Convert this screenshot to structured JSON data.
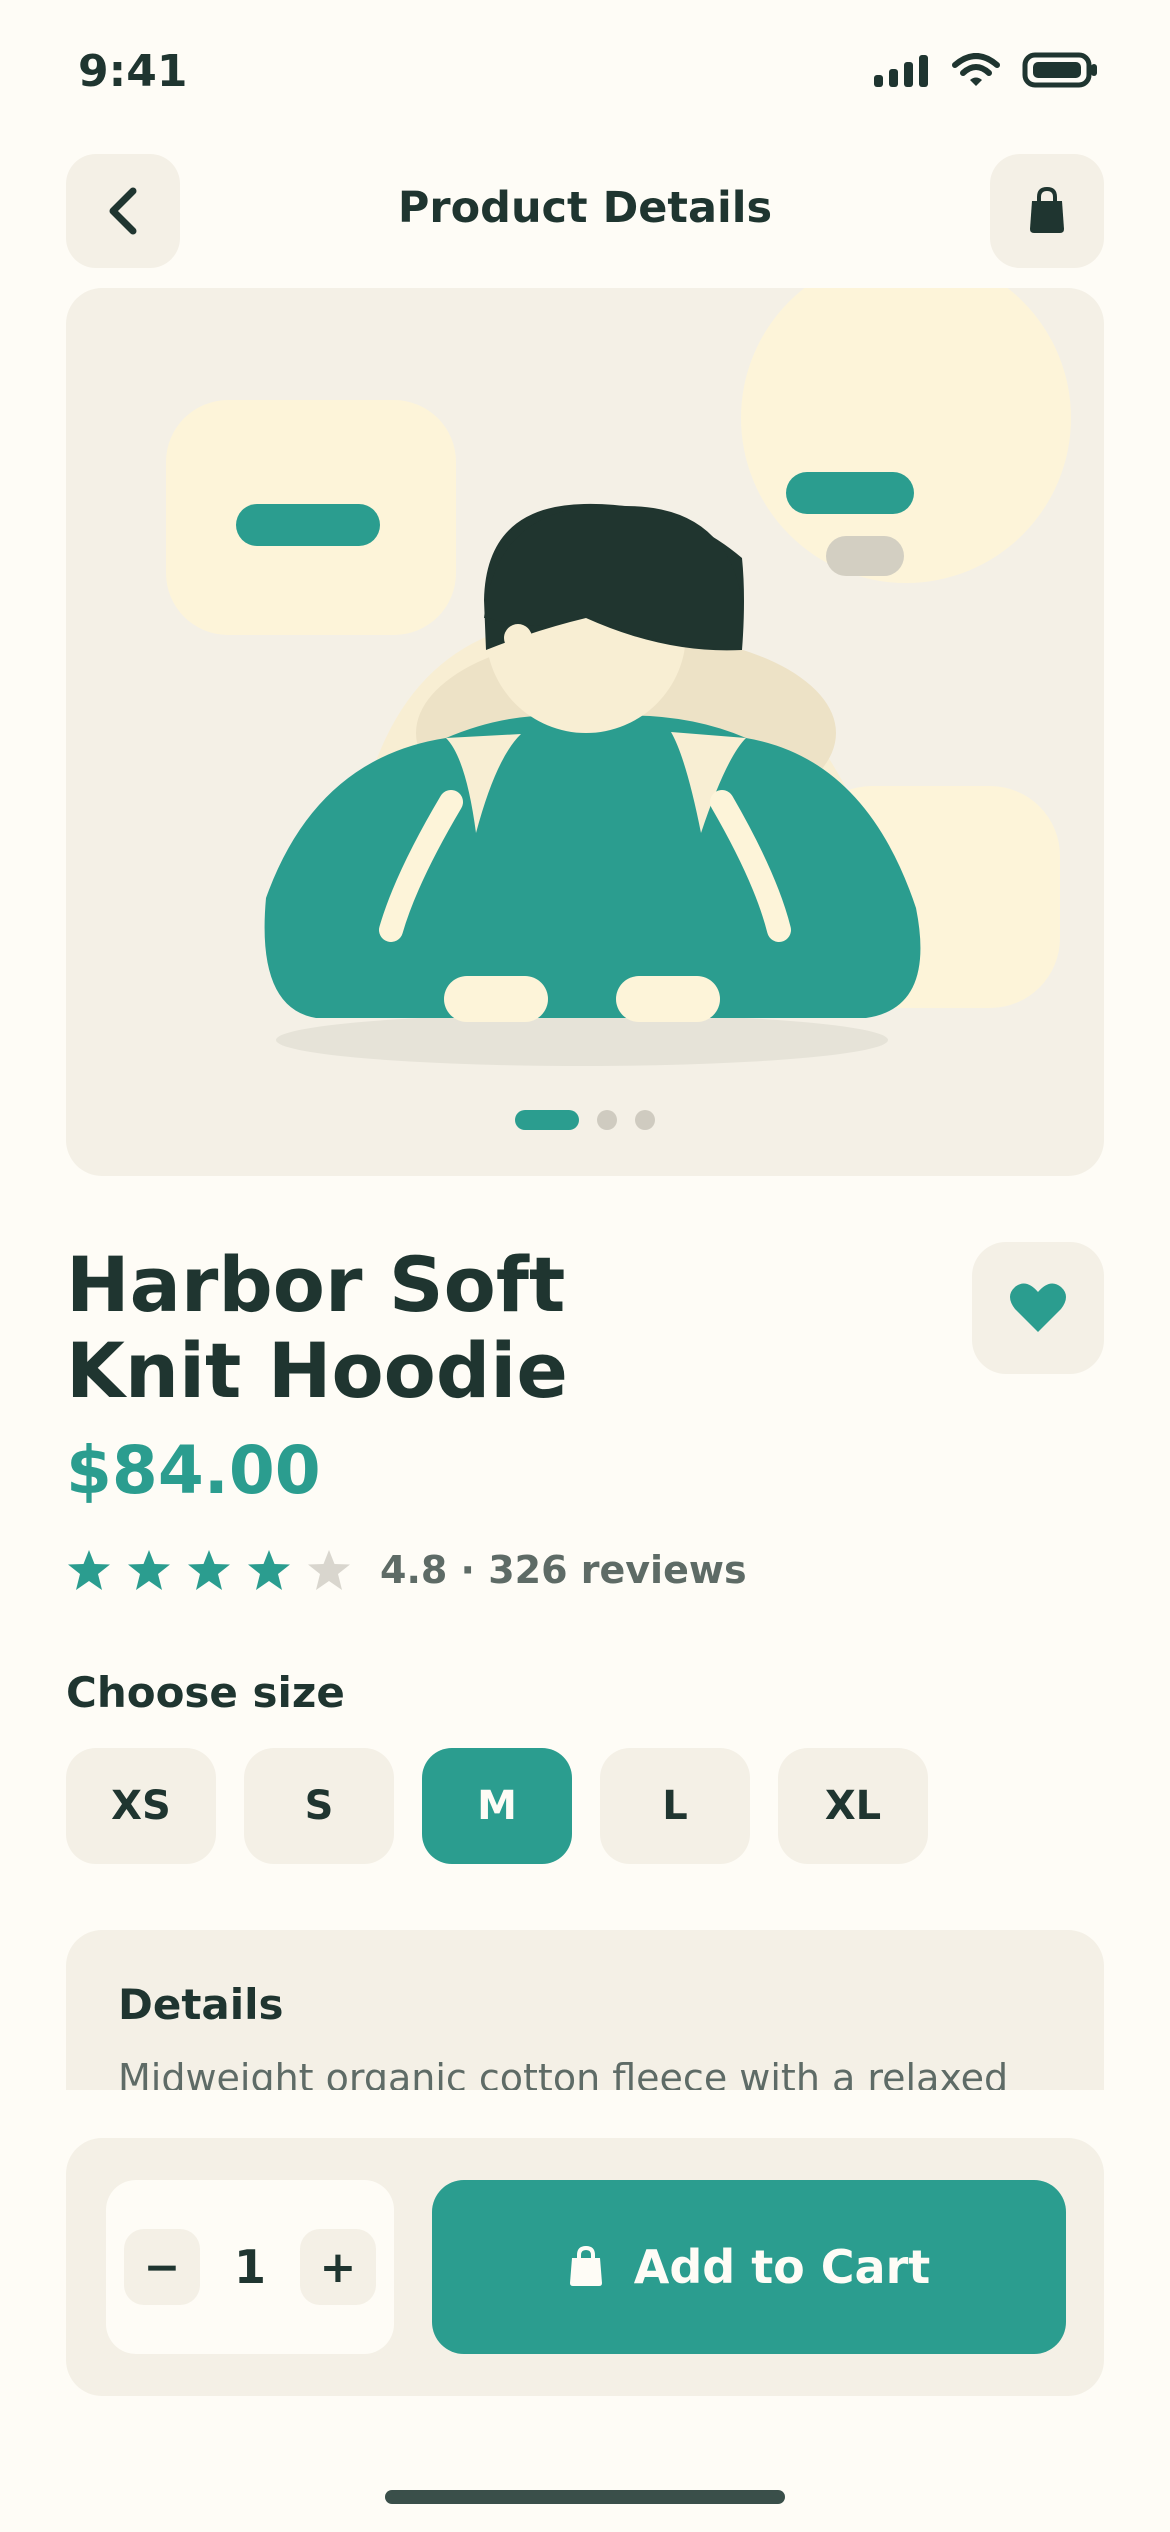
{
  "status_bar": {
    "time": "9:41",
    "icons": [
      "signal-icon",
      "wifi-icon",
      "battery-icon"
    ]
  },
  "header": {
    "title": "Product Details",
    "back_icon": "chevron-left-icon",
    "bag_icon": "shopping-bag-icon"
  },
  "gallery": {
    "image_count": 3,
    "active_index": 0
  },
  "product": {
    "name": "Harbor Soft Knit Hoodie",
    "price": "$84.00",
    "rating": 4.8,
    "rating_text": "4.8 · 326 reviews",
    "stars_filled": 4,
    "stars_total": 5
  },
  "size": {
    "label": "Choose size",
    "options": [
      "XS",
      "S",
      "M",
      "L",
      "XL"
    ],
    "selected": "M"
  },
  "details": {
    "title": "Details",
    "text": "Midweight organic cotton fleece with a relaxed"
  },
  "cart": {
    "quantity": "1",
    "minus_label": "−",
    "plus_label": "+",
    "add_label": "Add to Cart"
  },
  "colors": {
    "accent": "#2B9D8F",
    "background": "#FEFCF6",
    "card": "#F4F0E6",
    "text": "#1F3530",
    "muted": "#5E6B66"
  }
}
